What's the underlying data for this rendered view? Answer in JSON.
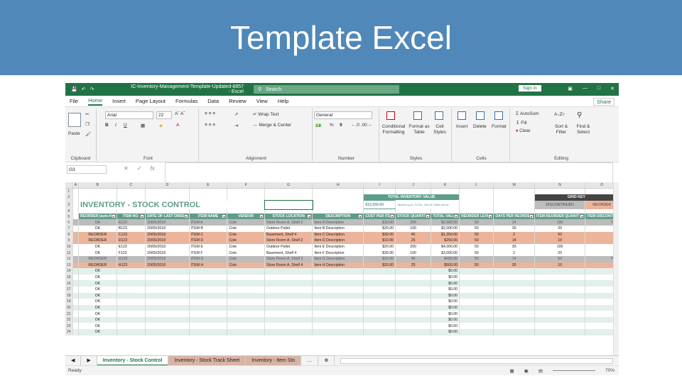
{
  "banner": {
    "title": "Template Excel"
  },
  "titlebar": {
    "filename": "IC-Inventory-Management-Template-Updated-8857 - Excel",
    "search_placeholder": "Search",
    "signin": "Sign in"
  },
  "menu": [
    "File",
    "Home",
    "Insert",
    "Page Layout",
    "Formulas",
    "Data",
    "Review",
    "View",
    "Help"
  ],
  "share": "Share",
  "ribbon": {
    "clipboard": {
      "label": "Clipboard",
      "paste": "Paste"
    },
    "font": {
      "label": "Font",
      "name": "Arial",
      "size": "22",
      "bold": "B",
      "italic": "I",
      "underline": "U"
    },
    "alignment": {
      "label": "Alignment",
      "wrap": "Wrap Text",
      "merge": "Merge & Center"
    },
    "number": {
      "label": "Number",
      "format": "General",
      "percent": "%",
      "comma": "9"
    },
    "styles": {
      "label": "Styles",
      "conditional": "Conditional Formatting",
      "format_table": "Format as Table",
      "cell_styles": "Cell Styles"
    },
    "cells": {
      "label": "Cells",
      "insert": "Insert",
      "delete": "Delete",
      "format": "Format"
    },
    "editing": {
      "label": "Editing",
      "autosum": "AutoSum",
      "fill": "Fill",
      "clear": "Clear",
      "sort": "Sort & Filter",
      "find": "Find & Select"
    }
  },
  "formula_bar": {
    "name_box": "G3",
    "fx": "fx",
    "value": ""
  },
  "columns": [
    "A",
    "B",
    "C",
    "D",
    "E",
    "F",
    "G",
    "H",
    "I",
    "J",
    "K",
    "L",
    "M",
    "N",
    "O"
  ],
  "sheet": {
    "title": "INVENTORY - STOCK CONTROL",
    "total_label": "TOTAL INVENTORY VALUE",
    "total_value": "$13,550.00",
    "total_note": "*Based upon TOTAL VALUE fields below",
    "grid_key": "GRID KEY",
    "key_discontinued": "DISCONTINUED",
    "key_reorder": "REORDER",
    "headers": [
      "REORDER (auto-fill)",
      "ITEM NO.",
      "DATE OF LAST ORDER",
      "ITEM NAME",
      "VENDOR",
      "STOCK LOCATION",
      "DESCRIPTION",
      "COST PER ITEM",
      "STOCK QUANTITY",
      "TOTAL VALUE",
      "REORDER LEVEL",
      "DAYS PER REORDER",
      "ITEM REORDER QUANTITY",
      "ITEM DISCONTIN"
    ],
    "rows": [
      {
        "n": "6",
        "style": "gray",
        "cells": [
          "OK",
          "A123",
          "20/05/2018",
          "ITEM A",
          "Cole",
          "Store Room A, Shelf 2",
          "Item A Description",
          "$10.00",
          "200",
          "$2,000.00",
          "50",
          "14",
          "100",
          "Yes"
        ]
      },
      {
        "n": "7",
        "style": "white",
        "cells": [
          "OK",
          "B123",
          "20/05/2018",
          "ITEM B",
          "Cole",
          "Outdoor Pallet",
          "Item B Description",
          "$20.00",
          "100",
          "$2,000.00",
          "50",
          "30",
          "20",
          ""
        ]
      },
      {
        "n": "8",
        "style": "orange",
        "cells": [
          "REORDER",
          "C123",
          "20/05/2018",
          "ITEM C",
          "Cole",
          "Basement, Shelf 4",
          "Item C Description",
          "$30.00",
          "45",
          "$1,350.00",
          "50",
          "2",
          "50",
          ""
        ]
      },
      {
        "n": "9",
        "style": "orange",
        "cells": [
          "REORDER",
          "D123",
          "20/05/2018",
          "ITEM D",
          "Cole",
          "Store Room A, Shelf 2",
          "Item D Description",
          "$10.00",
          "25",
          "$250.00",
          "50",
          "14",
          "10",
          ""
        ]
      },
      {
        "n": "10",
        "style": "white",
        "cells": [
          "OK",
          "E123",
          "20/05/2018",
          "ITEM E",
          "Cole",
          "Outdoor Pallet",
          "Item E Description",
          "$20.00",
          "200",
          "$4,000.00",
          "50",
          "30",
          "100",
          ""
        ]
      },
      {
        "n": "11",
        "style": "white",
        "cells": [
          "OK",
          "F123",
          "20/05/2018",
          "ITEM F",
          "Cole",
          "Basement, Shelf 4",
          "Item F Description",
          "$30.00",
          "100",
          "$3,000.00",
          "50",
          "2",
          "20",
          ""
        ]
      },
      {
        "n": "12",
        "style": "gray",
        "cells": [
          "REORDER",
          "G123",
          "20/05/2018",
          "ITEM G",
          "Cole",
          "Store Room A, Shelf 2",
          "Item G Description",
          "$10.00",
          "45",
          "$450.00",
          "50",
          "14",
          "50",
          "Yes"
        ]
      },
      {
        "n": "13",
        "style": "orange",
        "cells": [
          "REORDER",
          "H123",
          "20/05/2018",
          "ITEM H",
          "Cole",
          "Store Room A, Shelf 4",
          "Item H Description",
          "$20.00",
          "25",
          "$500.00",
          "50",
          "30",
          "10",
          ""
        ]
      }
    ],
    "empty_rows": [
      "14",
      "15",
      "16",
      "17",
      "18",
      "19",
      "20",
      "21",
      "22",
      "23",
      "24"
    ],
    "empty_status": "OK",
    "empty_total": "$0.00"
  },
  "tabs": [
    "Inventory - Stock Control",
    "Inventory - Stock Track Sheet",
    "Inventory - Item Sto"
  ],
  "status": {
    "ready": "Ready",
    "zoom": "70%"
  }
}
